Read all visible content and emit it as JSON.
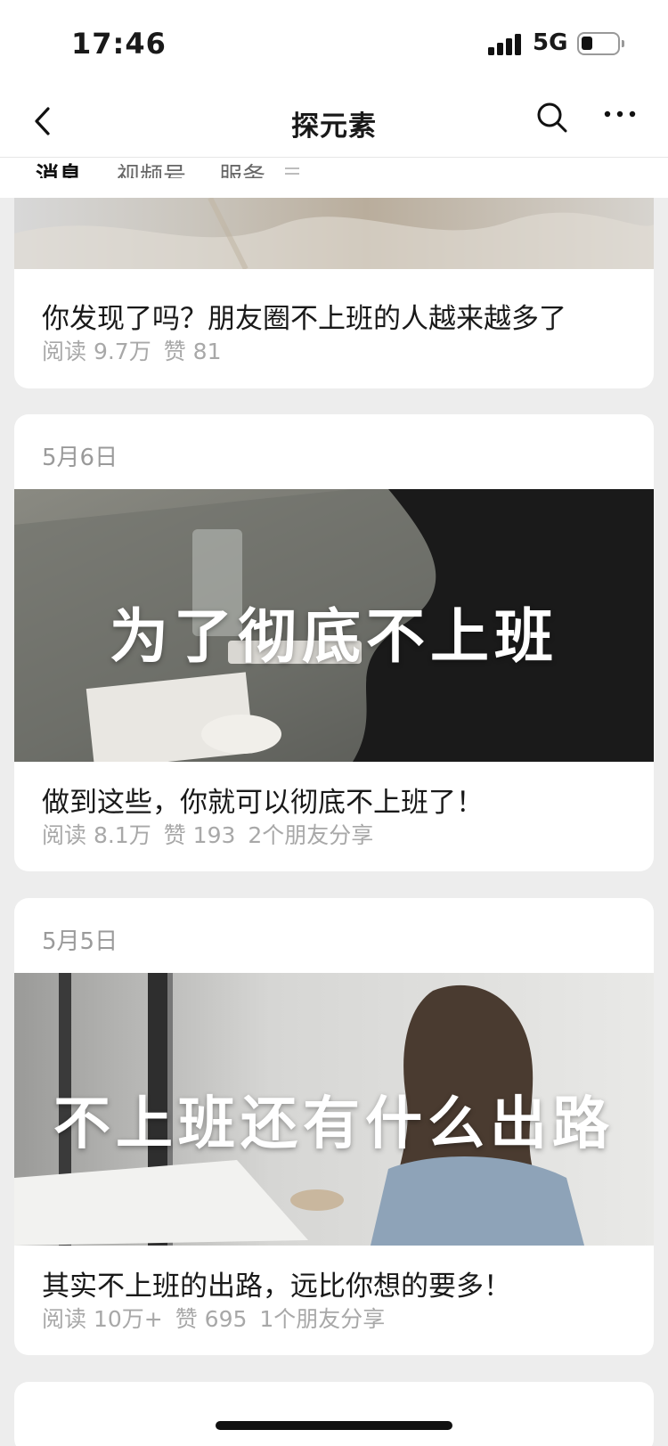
{
  "status_bar": {
    "time": "17:46",
    "network": "5G",
    "battery_level": 0.3
  },
  "nav": {
    "title": "探元素",
    "back_icon": "chevron-left-icon",
    "search_icon": "search-icon",
    "more_icon": "more-horizontal-icon"
  },
  "tabs": [
    {
      "label": "消息",
      "active": true
    },
    {
      "label": "视频号",
      "active": false
    },
    {
      "label": "服务",
      "active": false
    }
  ],
  "articles": [
    {
      "title": "你发现了吗？朋友圈不上班的人越来越多了",
      "reads": "阅读 9.7万",
      "likes": "赞 81"
    },
    {
      "date": "5月6日",
      "overlay": "为了彻底不上班",
      "title": "做到这些，你就可以彻底不上班了！",
      "reads": "阅读 8.1万",
      "likes": "赞 193",
      "shares": "2个朋友分享"
    },
    {
      "date": "5月5日",
      "overlay": "不上班还有什么出路",
      "title": "其实不上班的出路，远比你想的要多！",
      "reads": "阅读 10万+",
      "likes": "赞 695",
      "shares": "1个朋友分享"
    }
  ]
}
